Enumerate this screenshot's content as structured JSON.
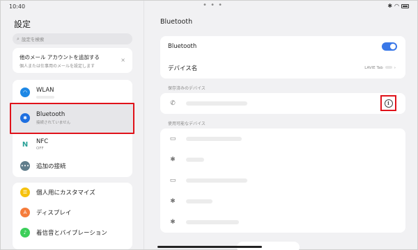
{
  "statusbar": {
    "time": "10:40",
    "dots": "• • •"
  },
  "left_pane": {
    "title": "設定",
    "search_placeholder": "設定を検索",
    "mail_card": {
      "title": "他のメール アカウントを追加する",
      "subtitle": "個人または仕事用のメールを設定します",
      "close": "×"
    },
    "group1": [
      {
        "label": "WLAN",
        "icon": "wifi-icon",
        "color": "#1e88e5"
      },
      {
        "label": "Bluetooth",
        "sub": "接続されていません",
        "icon": "bluetooth-icon",
        "color": "#1e6fe0"
      },
      {
        "label": "NFC",
        "sub": "OFF",
        "icon": "nfc-icon",
        "color": "#2aa198"
      },
      {
        "label": "追加の接続",
        "icon": "more-connections-icon",
        "color": "#607d8b"
      }
    ],
    "group2": [
      {
        "label": "個人用にカスタマイズ",
        "icon": "personalize-icon",
        "color": "#f6c20d"
      },
      {
        "label": "ディスプレイ",
        "icon": "display-icon",
        "color": "#f57c3b"
      },
      {
        "label": "着信音とバイブレーション",
        "icon": "sound-icon",
        "color": "#3ccf5a"
      }
    ]
  },
  "right_pane": {
    "title": "Bluetooth",
    "bluetooth_row": {
      "label": "Bluetooth",
      "enabled": true
    },
    "device_name_row": {
      "label": "デバイス名",
      "value": "LAVIE Tab"
    },
    "saved_section": "保存済みのデバイス",
    "available_section": "使用可能なデバイス"
  },
  "colors": {
    "accent": "#3a78e8",
    "highlight": "#e0121a"
  }
}
